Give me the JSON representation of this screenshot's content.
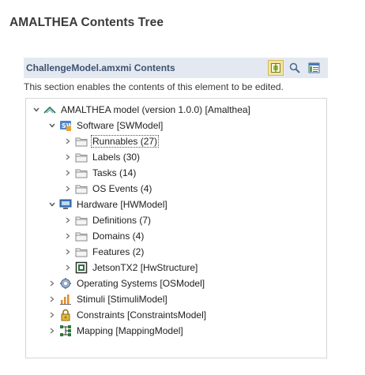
{
  "page": {
    "title": "AMALTHEA Contents Tree"
  },
  "section": {
    "title": "ChallengeModel.amxmi Contents",
    "description": "This section enables the contents of this element to be edited.",
    "toolbar": {
      "buttons": [
        "link-with-editor-icon",
        "search-icon",
        "details-icon"
      ]
    }
  },
  "tree": {
    "root": "AMALTHEA model (version 1.0.0) [Amalthea]",
    "software": {
      "label": "Software [SWModel]",
      "children": [
        "Runnables (27)",
        "Labels (30)",
        "Tasks (14)",
        "OS Events (4)"
      ]
    },
    "hardware": {
      "label": "Hardware [HWModel]",
      "children": [
        "Definitions (7)",
        "Domains (4)",
        "Features (2)"
      ],
      "structure": "JetsonTX2 [HwStructure]"
    },
    "os": "Operating Systems [OSModel]",
    "stimuli": "Stimuli [StimuliModel]",
    "constraints": "Constraints [ConstraintsModel]",
    "mapping": "Mapping [MappingModel]"
  },
  "colors": {
    "header_bg": "#e4e9f1",
    "header_text": "#3d5271",
    "folder": "#9a9a9a",
    "chevron": "#555555"
  }
}
